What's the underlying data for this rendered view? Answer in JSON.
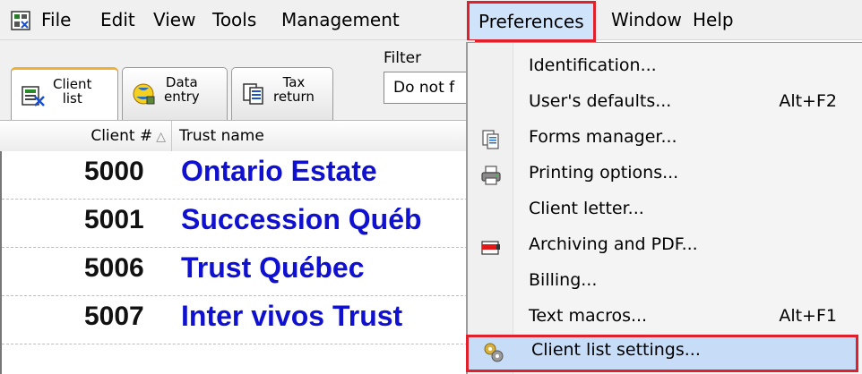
{
  "menubar": {
    "items": [
      "File",
      "Edit",
      "View",
      "Tools",
      "Management",
      "Preferences",
      "Window",
      "Help"
    ]
  },
  "tabs": [
    {
      "line1": "Client",
      "line2": "list",
      "icon": "client-list-icon"
    },
    {
      "line1": "Data",
      "line2": "entry",
      "icon": "data-entry-icon"
    },
    {
      "line1": "Tax",
      "line2": "return",
      "icon": "tax-return-icon"
    }
  ],
  "filter": {
    "label": "Filter",
    "value": "Do not f"
  },
  "table": {
    "headers": [
      "Client #",
      "Trust name"
    ],
    "rows": [
      {
        "number": "5000",
        "name": "Ontario Estate"
      },
      {
        "number": "5001",
        "name": "Succession Québ"
      },
      {
        "number": "5006",
        "name": "Trust Québec"
      },
      {
        "number": "5007",
        "name": "Inter vivos Trust"
      }
    ]
  },
  "dropdown": {
    "items": [
      {
        "label": "Identification...",
        "shortcut": "",
        "icon": ""
      },
      {
        "label": "User's defaults...",
        "shortcut": "Alt+F2",
        "icon": ""
      },
      {
        "label": "Forms manager...",
        "shortcut": "",
        "icon": "forms-manager-icon"
      },
      {
        "label": "Printing options...",
        "shortcut": "",
        "icon": "printer-icon"
      },
      {
        "label": "Client letter...",
        "shortcut": "",
        "icon": ""
      },
      {
        "label": "Archiving and PDF...",
        "shortcut": "",
        "icon": "pdf-icon"
      },
      {
        "label": "Billing...",
        "shortcut": "",
        "icon": ""
      },
      {
        "label": "Text macros...",
        "shortcut": "Alt+F1",
        "icon": ""
      },
      {
        "label": "Client list settings...",
        "shortcut": "",
        "icon": "gears-icon"
      }
    ]
  },
  "colors": {
    "highlight_border": "#e0202a",
    "trust_name": "#1010d0",
    "menu_highlight": "#cfe3fa"
  }
}
